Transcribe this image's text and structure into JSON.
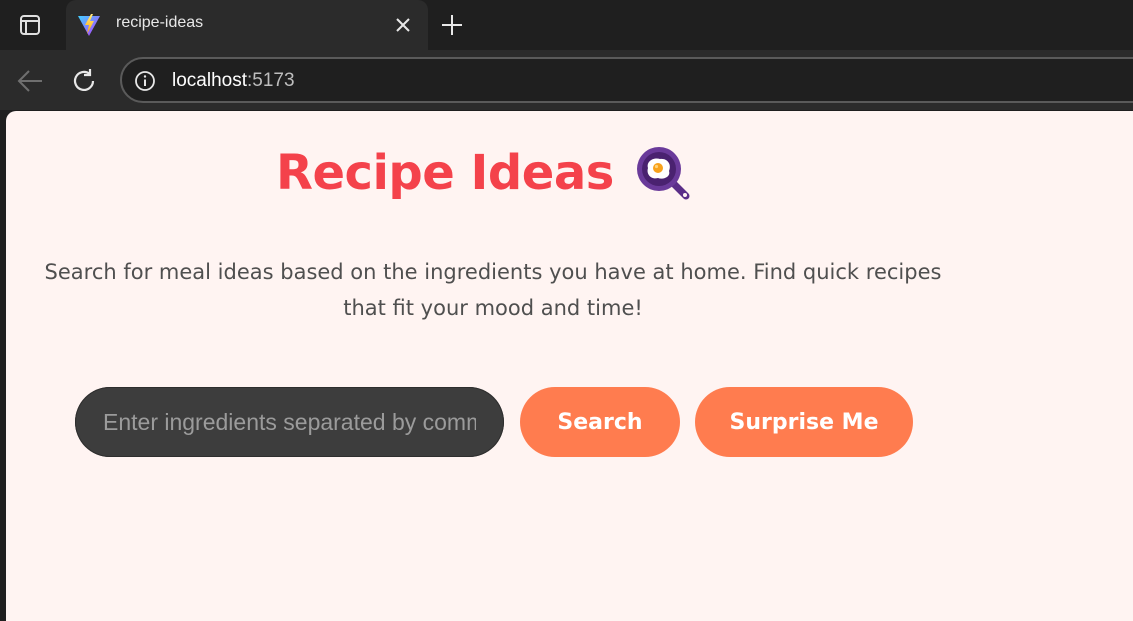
{
  "browser": {
    "tab": {
      "title": "recipe-ideas"
    },
    "address_bar": {
      "host": "localhost",
      "port": ":5173"
    }
  },
  "page": {
    "title": "Recipe Ideas",
    "title_icon": "frying-pan-egg-icon",
    "subtitle": "Search for meal ideas based on the ingredients you have at home. Find quick recipes that fit your mood and time!",
    "search": {
      "placeholder": "Enter ingredients separated by commas",
      "value": ""
    },
    "buttons": {
      "search_label": "Search",
      "surprise_label": "Surprise Me"
    }
  },
  "colors": {
    "accent_red": "#f4424b",
    "button_orange": "#ff7c4f",
    "page_background": "#fff4f2",
    "input_background": "#3d3d3d"
  }
}
